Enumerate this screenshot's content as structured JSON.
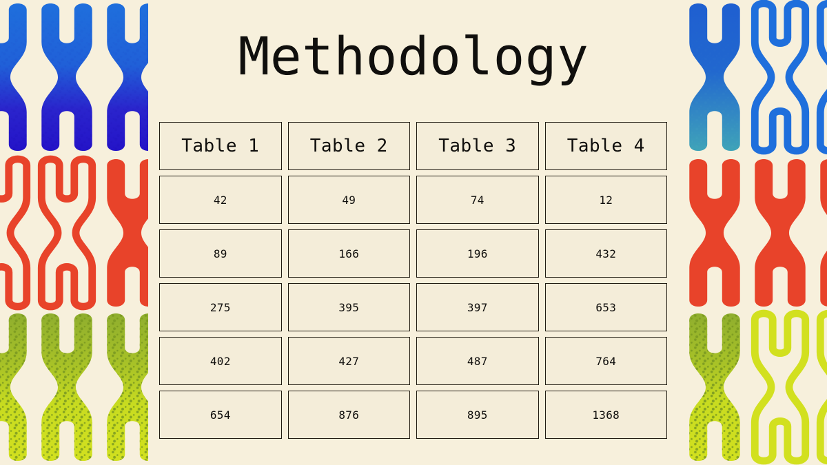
{
  "slide": {
    "title": "Methodology",
    "background_color": "#f7f0dc",
    "text_color": "#100f0d",
    "border_color": "#211c12"
  },
  "table": {
    "headers": [
      "Table 1",
      "Table 2",
      "Table 3",
      "Table 4"
    ],
    "rows": [
      [
        "42",
        "49",
        "74",
        "12"
      ],
      [
        "89",
        "166",
        "196",
        "432"
      ],
      [
        "275",
        "395",
        "397",
        "653"
      ],
      [
        "402",
        "427",
        "487",
        "764"
      ],
      [
        "654",
        "876",
        "895",
        "1368"
      ]
    ]
  },
  "decorations": {
    "left_band": {
      "name": "chromosome-column-left",
      "rows": [
        {
          "color_top": "#1f6fdc",
          "color_bottom": "#2413c8",
          "style": "speckled-gradient"
        },
        {
          "color": "#e8432a",
          "style": "outline"
        },
        {
          "color_top": "#8fae2e",
          "color_bottom": "#d2e01f",
          "style": "speckled-gradient"
        }
      ]
    },
    "right_band": {
      "name": "chromosome-column-right",
      "rows": [
        {
          "color_top": "#1f5fd0",
          "color_bottom": "#3fa3b8",
          "style": "speckled-gradient"
        },
        {
          "color": "#e8432a",
          "style": "solid"
        },
        {
          "color_top": "#8fae2e",
          "color_bottom": "#d2e01f",
          "style": "speckled-gradient"
        }
      ]
    },
    "palette": {
      "blue": "#1f6fdc",
      "blue_dark": "#2413c8",
      "teal": "#3fa3b8",
      "red": "#e8432a",
      "green_dark": "#8fae2e",
      "green_bright": "#d2e01f"
    }
  }
}
